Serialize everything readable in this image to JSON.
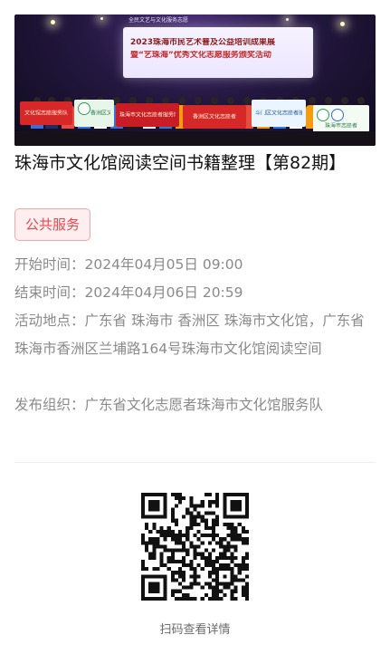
{
  "hero": {
    "screen_small": "全民文艺与文化服务志愿",
    "screen_line1": "2023珠海市民艺术普及公益培训成果展",
    "screen_line2": "暨“艺珠海”优秀文化志愿服务颁奖活动",
    "banners": [
      "文化馆志愿服务队",
      "香洲区文化馆",
      "珠海市文化志愿者服务队",
      "香洲区文化志愿者",
      "斗门区文化志愿者服务队",
      "珠海市志愿者"
    ]
  },
  "event": {
    "title": "珠海市文化馆阅读空间书籍整理【第82期】",
    "tag": "公共服务",
    "start_label": "开始时间：",
    "start_value": "2024年04月05日 09:00",
    "end_label": "结束时间：",
    "end_value": "2024年04月06日 20:59",
    "location_label": "活动地点：",
    "location_value": "广东省 珠海市 香洲区 珠海市文化馆，广东省珠海市香洲区兰埔路164号珠海市文化馆阅读空间",
    "organizer_label": "发布组织：",
    "organizer_value": "广东省文化志愿者珠海市文化馆服务队"
  },
  "qr": {
    "caption": "扫码查看详情"
  },
  "colors": {
    "tag_text": "#e8474f",
    "tag_bg": "#fdeff0",
    "tag_border": "#f3a6ad",
    "info_text": "#8a8a8a"
  }
}
